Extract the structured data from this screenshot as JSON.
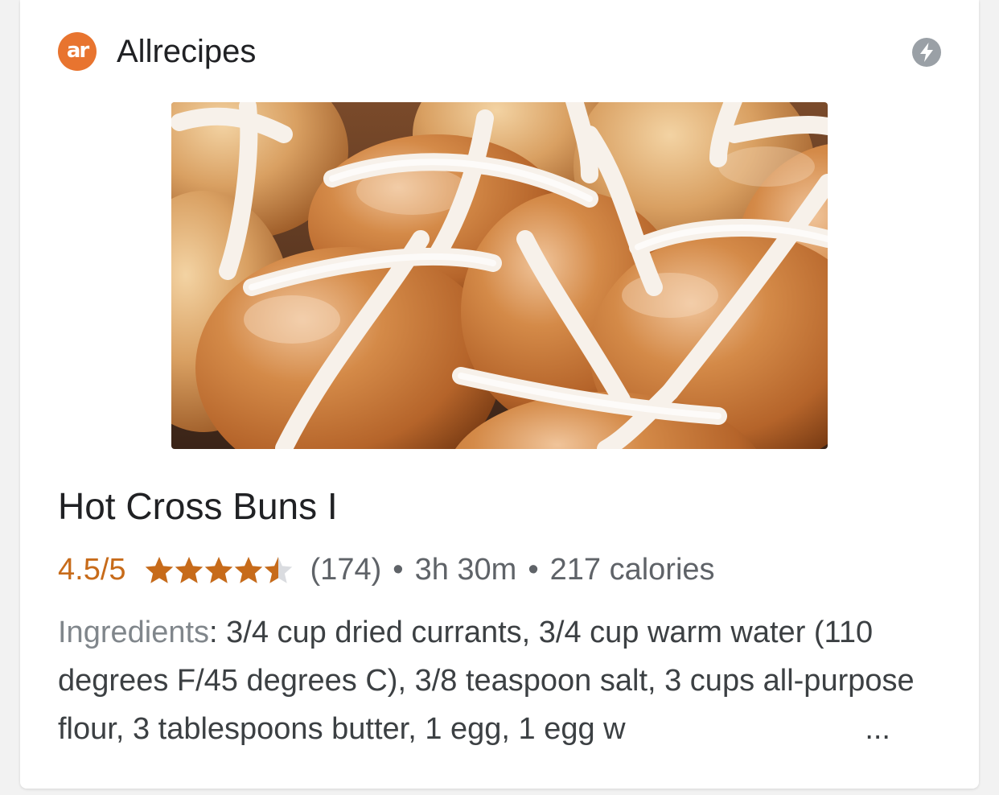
{
  "source": {
    "logo_text": "ar",
    "name": "Allrecipes"
  },
  "icons": {
    "amp": "lightning-bolt-icon",
    "rating": "star-icon"
  },
  "colors": {
    "brand": "#e8742f",
    "rating": "#c76b1a",
    "secondary_text": "#5f6368"
  },
  "recipe": {
    "title": "Hot Cross Buns I",
    "rating_text": "4.5/5",
    "rating_value": 4.5,
    "rating_max": 5,
    "reviews": "(174)",
    "separator": "•",
    "time": "3h 30m",
    "calories": "217 calories",
    "ingredients_label": "Ingredients",
    "ingredients_text": ": 3/4 cup dried currants, 3/4 cup warm water (110 degrees F/45 degrees C), 3/8 teaspoon salt, 3 cups all-purpose flour, 3 tablespoons butter, 1 egg, 1 egg w",
    "ellipsis": "..."
  }
}
